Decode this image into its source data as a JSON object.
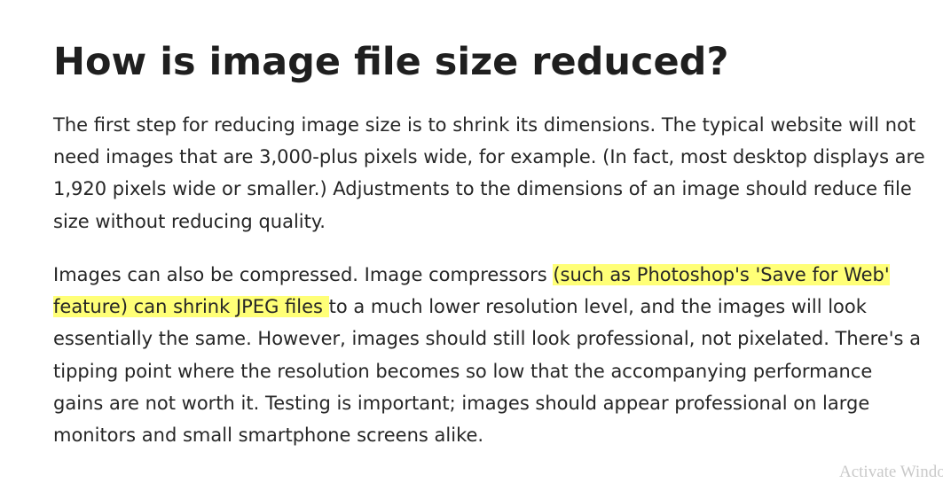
{
  "article": {
    "title": "How is image file size reduced?",
    "para1": "The first step for reducing image size is to shrink its dimensions. The typical website will not need images that are 3,000-plus pixels wide, for example. (In fact, most desktop displays are 1,920 pixels wide or smaller.) Adjustments to the dimensions of an image should reduce file size without reducing quality.",
    "para2_before": "Images can also be compressed. Image compressors ",
    "para2_highlight": "(such as Photoshop's 'Save for Web' feature) can shrink JPEG files ",
    "para2_after": "to a much lower resolution level, and the images will look essentially the same. However, images should still look professional, not pixelated. There's a tipping point where the resolution becomes so low that the accompanying performance gains are not worth it. Testing is important; images should appear professional on large monitors and small smartphone screens alike."
  },
  "watermark": {
    "text": "Activate Windows"
  },
  "colors": {
    "highlight": "#ffff77",
    "text": "#262626",
    "background": "#ffffff"
  }
}
